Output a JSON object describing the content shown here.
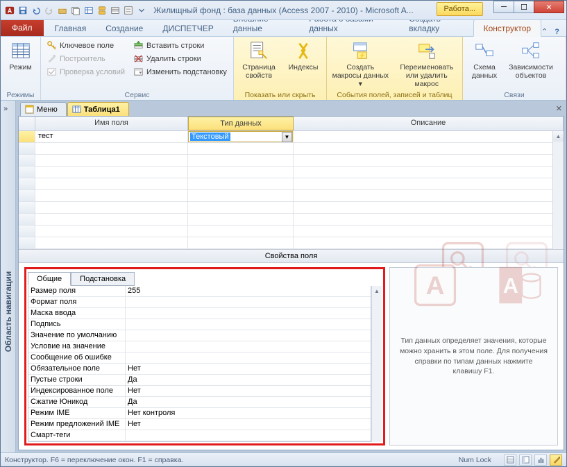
{
  "titlebar": {
    "title": "Жилищный фонд : база данных (Access 2007 - 2010)  -  Microsoft A...",
    "context_tab": "Работа..."
  },
  "ribbon_tabs": {
    "file": "Файл",
    "home": "Главная",
    "create": "Создание",
    "dispatcher": "ДИСПЕТЧЕР",
    "external": "Внешние данные",
    "dbtools": "Работа с базами данных",
    "newtab": "Создать вкладку",
    "design": "Конструктор"
  },
  "ribbon": {
    "views": {
      "mode": "Режим",
      "group": "Режимы"
    },
    "tools": {
      "primary_key": "Ключевое поле",
      "builder": "Построитель",
      "test_rules": "Проверка условий",
      "insert_rows": "Вставить строки",
      "delete_rows": "Удалить строки",
      "modify_lookups": "Изменить подстановку",
      "group": "Сервис"
    },
    "showhide": {
      "prop_sheet": "Страница свойств",
      "indexes": "Индексы",
      "group": "Показать или скрыть"
    },
    "events": {
      "data_macros": "Создать макросы данных ▾",
      "rename_macro": "Переименовать или удалить макрос",
      "group": "События полей, записей и таблиц"
    },
    "rel": {
      "schema": "Схема данных",
      "deps": "Зависимости объектов",
      "group": "Связи"
    }
  },
  "navpane": {
    "label": "Область навигации"
  },
  "object_tabs": {
    "menu": "Меню",
    "table1": "Таблица1"
  },
  "field_grid": {
    "col_name": "Имя поля",
    "col_type": "Тип данных",
    "col_desc": "Описание",
    "row1_name": "тест",
    "row1_type": "Текстовый"
  },
  "props": {
    "band": "Свойства поля",
    "tab_general": "Общие",
    "tab_lookup": "Подстановка",
    "rows": [
      {
        "label": "Размер поля",
        "val": "255"
      },
      {
        "label": "Формат поля",
        "val": ""
      },
      {
        "label": "Маска ввода",
        "val": ""
      },
      {
        "label": "Подпись",
        "val": ""
      },
      {
        "label": "Значение по умолчанию",
        "val": ""
      },
      {
        "label": "Условие на значение",
        "val": ""
      },
      {
        "label": "Сообщение об ошибке",
        "val": ""
      },
      {
        "label": "Обязательное поле",
        "val": "Нет"
      },
      {
        "label": "Пустые строки",
        "val": "Да"
      },
      {
        "label": "Индексированное поле",
        "val": "Нет"
      },
      {
        "label": "Сжатие Юникод",
        "val": "Да"
      },
      {
        "label": "Режим IME",
        "val": "Нет контроля"
      },
      {
        "label": "Режим предложений IME",
        "val": "Нет"
      },
      {
        "label": "Смарт-теги",
        "val": ""
      }
    ],
    "hint": "Тип данных определяет значения, которые можно хранить в этом поле. Для получения справки по типам данных нажмите клавишу F1."
  },
  "status": {
    "left": "Конструктор.  F6 = переключение окон.  F1 = справка.",
    "numlock": "Num Lock"
  }
}
